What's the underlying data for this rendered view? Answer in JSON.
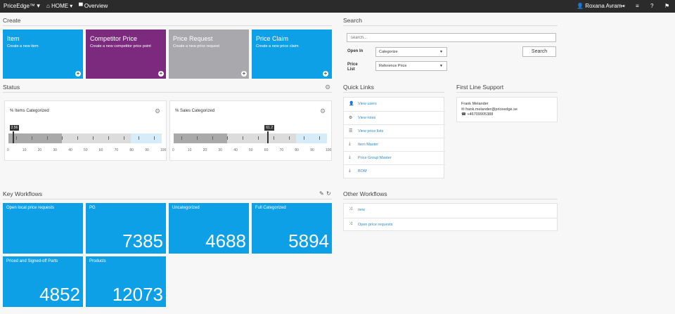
{
  "topbar": {
    "brand": "PriceEdge™",
    "home": "HOME",
    "overview": "Overview",
    "user": "Roxana Avram"
  },
  "create": {
    "title": "Create",
    "tiles": [
      {
        "title": "Item",
        "subtitle": "Create a new item",
        "color": "#0ea0e6"
      },
      {
        "title": "Competitor Price",
        "subtitle": "Create a new competitor price point",
        "color": "#7b2a7e"
      },
      {
        "title": "Price Request",
        "subtitle": "Create a new price request",
        "color": "#a9a9ad"
      },
      {
        "title": "Price Claim",
        "subtitle": "Create a new price claim",
        "color": "#0ea0e6"
      }
    ]
  },
  "search": {
    "title": "Search",
    "placeholder": "search...",
    "open_in_label": "Open In",
    "open_in_value": "Categorize",
    "price_list_label": "Price List",
    "price_list_value": "Reference Price",
    "button": "Search"
  },
  "status": {
    "title": "Status",
    "gauges": [
      {
        "title": "% Items Categorized",
        "value": 2.56,
        "value_label": "2.56"
      },
      {
        "title": "% Sales Categorized",
        "value": 61.2,
        "value_label": "61.2"
      }
    ],
    "ticks": [
      "0",
      "10",
      "20",
      "30",
      "40",
      "50",
      "60",
      "70",
      "80",
      "90",
      "100"
    ]
  },
  "quick_links": {
    "title": "Quick Links",
    "items": [
      {
        "label": "View users",
        "icon": "user-icon"
      },
      {
        "label": "View roles",
        "icon": "roles-icon"
      },
      {
        "label": "View price lists",
        "icon": "list-icon"
      },
      {
        "label": "Item Master",
        "icon": "download-icon"
      },
      {
        "label": "Price Group Master",
        "icon": "download-icon"
      },
      {
        "label": "BOM",
        "icon": "download-icon"
      }
    ]
  },
  "support": {
    "title": "First Line Support",
    "name": "Frank Melander",
    "email": "frank.melander@priceedge.se",
    "phone": "+46709905388"
  },
  "key_workflows": {
    "title": "Key Workflows",
    "tiles": [
      {
        "label": "Open local price requests",
        "value": ""
      },
      {
        "label": "PG",
        "value": "7385"
      },
      {
        "label": "Uncategorized",
        "value": "4688"
      },
      {
        "label": "Full Categorized",
        "value": "5894"
      },
      {
        "label": "Priced and Signed-off Parts",
        "value": "4852"
      },
      {
        "label": "Products",
        "value": "12073"
      }
    ]
  },
  "other_workflows": {
    "title": "Other Workflows",
    "items": [
      {
        "label": "new"
      },
      {
        "label": "Open price requests"
      }
    ]
  }
}
